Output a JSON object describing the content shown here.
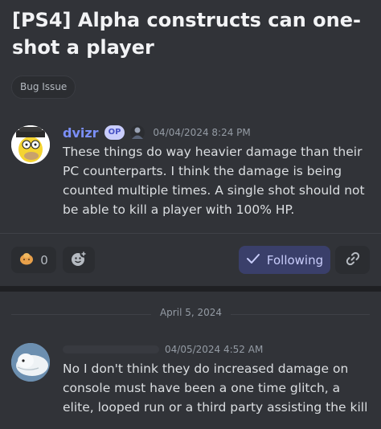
{
  "thread": {
    "title": "[PS4] Alpha constructs can one-shot a player",
    "tag": "Bug Issue"
  },
  "post": {
    "author": "dvizr",
    "badge": "OP",
    "timestamp": "04/04/2024 8:24 PM",
    "text": "These things do way heavier damage than their PC counterparts. I think the damage is being counted multiple times. A single shot should not be able to kill a player with 100% HP."
  },
  "actions": {
    "reaction_count": "0",
    "reaction_icon": "cookie-emoji",
    "add_reaction_icon": "add-reaction-icon",
    "follow_label": "Following",
    "follow_icon": "check-icon",
    "link_icon": "link-icon"
  },
  "divider": {
    "date": "April 5, 2024"
  },
  "reply": {
    "timestamp": "04/05/2024 4:52 AM",
    "text": "No I don't think they do increased damage on console must have been a one time glitch, a elite, looped run or a third party assisting the kill"
  },
  "colors": {
    "background": "#313338",
    "author": "#7b8ff7",
    "follow_bg": "#3a3f6a",
    "follow_text": "#c9cdfb"
  }
}
